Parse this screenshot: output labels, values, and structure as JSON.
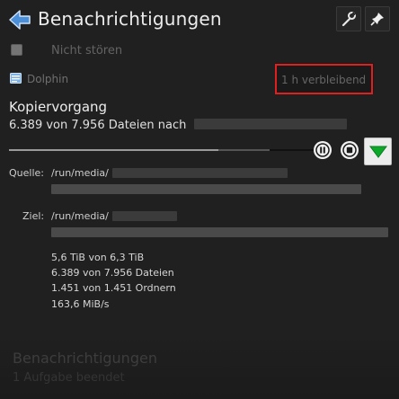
{
  "header": {
    "title": "Benachrichtigungen",
    "back_icon": "back-arrow-icon",
    "configure_icon": "wrench-icon",
    "pin_icon": "pin-icon"
  },
  "do_not_disturb": {
    "label": "Nicht stören",
    "checked": false
  },
  "notification": {
    "app_name": "Dolphin",
    "time_remaining": "1 h verbleibend",
    "title": "Kopiervorgang",
    "subtitle": "6.389 von 7.956 Dateien nach",
    "progress_fraction": 0.803,
    "source_label": "Quelle:",
    "source_value": "/run/media/",
    "dest_label": "Ziel:",
    "dest_value": "/run/media/",
    "stats": [
      "5,6 TiB von 6,3 TiB",
      "6.389 von 7.956 Dateien",
      "1.451 von 1.451 Ordnern",
      "163,6 MiB/s"
    ]
  },
  "background": {
    "title": "Benachrichtigungen",
    "subtitle": "1 Aufgabe beendet"
  },
  "colors": {
    "background": "#202020",
    "highlight": "#e0201f",
    "accent_green": "#0da82a",
    "back_blue": "#4a8fd8"
  }
}
